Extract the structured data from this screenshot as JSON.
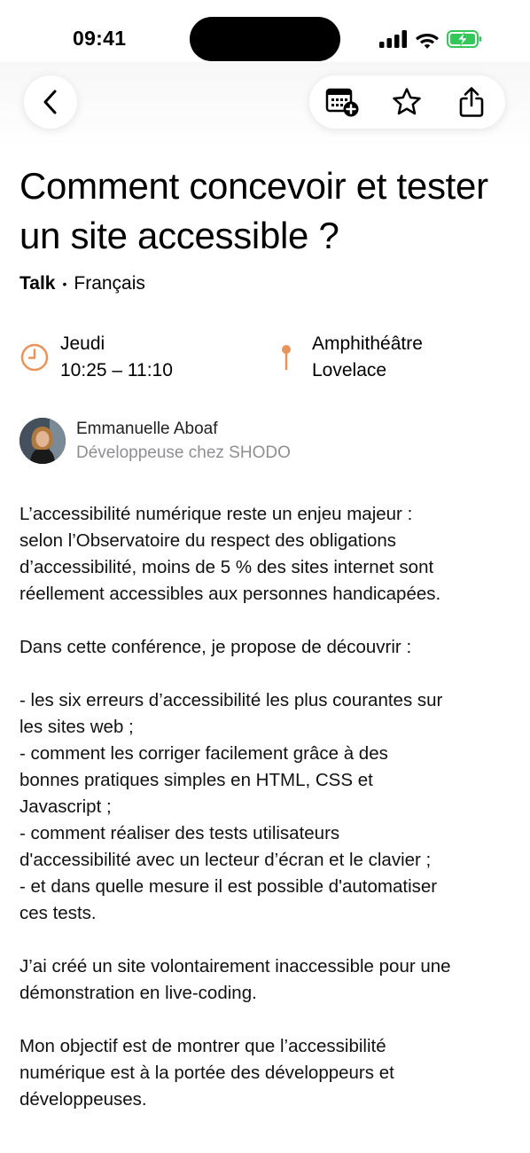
{
  "status_bar": {
    "time": "09:41"
  },
  "nav": {
    "back_icon": "chevron-left-icon",
    "actions": [
      "add-to-calendar-icon",
      "star-icon",
      "share-icon"
    ]
  },
  "talk": {
    "title": "Comment concevoir et tester un site accessible ?",
    "type": "Talk",
    "separator": "•",
    "language": "Français",
    "day": "Jeudi",
    "time_range": "10:25 – 11:10",
    "room_line1": "Amphithéâtre",
    "room_line2": "Lovelace"
  },
  "speaker": {
    "name": "Emmanuelle Aboaf",
    "role": "Développeuse chez SHODO"
  },
  "description": {
    "p1": "L’accessibilité numérique reste un enjeu majeur :\nselon l’Observatoire du respect des obligations\nd’accessibilité, moins de 5 % des sites internet sont\nréellement accessibles aux personnes handicapées.",
    "p2": "Dans cette conférence, je propose de découvrir :",
    "p3": "- les six erreurs d’accessibilité les plus courantes sur\nles sites web ;\n- comment les corriger facilement grâce à des\nbonnes pratiques simples en HTML, CSS et\nJavascript ;\n- comment réaliser des tests utilisateurs\nd'accessibilité avec un lecteur d’écran et le clavier ;\n- et dans quelle mesure il est possible d'automatiser\nces tests.",
    "p4": "J’ai créé un site volontairement inaccessible pour une\ndémonstration en live-coding.",
    "p5": "Mon objectif est de montrer que l’accessibilité\nnumérique est à la portée des développeurs et\ndéveloppeuses."
  },
  "colors": {
    "accent": "#e8935a",
    "battery": "#34c759",
    "secondary_text": "#8e8e93"
  }
}
